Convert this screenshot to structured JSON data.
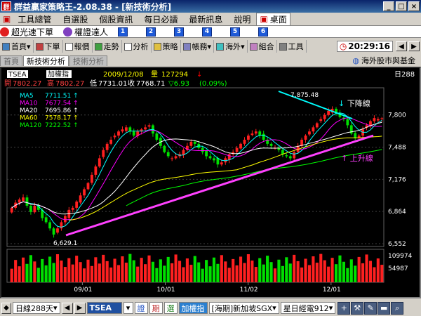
{
  "window": {
    "title": "群益贏家策略王-2.08.38 - [新技術分析]",
    "icon": "app-icon"
  },
  "menu": {
    "items": [
      "工具總管",
      "自選股",
      "個股資訊",
      "每日必讀",
      "最新訊息",
      "說明"
    ],
    "desktop": "桌面"
  },
  "quick": {
    "items": [
      "超光速下單",
      "權證達人"
    ],
    "numbers": [
      "1",
      "2",
      "3",
      "4",
      "5",
      "6"
    ]
  },
  "toolbar": {
    "items": [
      "首頁",
      "下單",
      "報價",
      "走勢",
      "分析",
      "策略",
      "帳務",
      "海外",
      "組合",
      "工具"
    ],
    "clock": "20:29:16"
  },
  "tabs": {
    "items": [
      "首頁",
      "新技術分析",
      "技術分析"
    ],
    "active": 1,
    "overseas": "海外股市與基金"
  },
  "chart_header": {
    "symbol": "TSEA",
    "name": "加權指",
    "date": "2009/12/08",
    "vol_label": "量",
    "vol": "127294",
    "open_label": "開",
    "open": "7802.27",
    "high_label": "高",
    "high": "7802.27",
    "low_label": "低",
    "low": "7731.01",
    "close_label": "收",
    "close": "7768.71",
    "change": "▽6.93",
    "pct": "(0.09%)",
    "period": "日288"
  },
  "ma_legend": [
    {
      "name": "MA5",
      "value": "7711.51",
      "color": "#00ffff"
    },
    {
      "name": "MA10",
      "value": "7677.54",
      "color": "#ff00ff"
    },
    {
      "name": "MA20",
      "value": "7695.86",
      "color": "#ffffff"
    },
    {
      "name": "MA60",
      "value": "7578.17",
      "color": "#ffff00"
    },
    {
      "name": "MA120",
      "value": "7222.52",
      "color": "#00ff00"
    }
  ],
  "annotations": {
    "high": "7,875.48",
    "low": "6,629.1",
    "down": "下降線",
    "up": "上升線"
  },
  "chart_data": {
    "type": "candlestick",
    "ylim": [
      6552,
      8050
    ],
    "yticks": [
      "7,800",
      "7,488",
      "7,176",
      "6,864",
      "6,552"
    ],
    "xticks": [
      "09/01",
      "10/01",
      "11/02",
      "12/01"
    ],
    "vol_ticks": [
      "109974",
      "54987"
    ],
    "closes": [
      6900,
      6950,
      6980,
      7000,
      6920,
      6860,
      6920,
      6880,
      6800,
      6760,
      6700,
      6640,
      6700,
      6760,
      6820,
      6880,
      6900,
      6960,
      7020,
      7080,
      7140,
      7220,
      7300,
      7380,
      7460,
      7520,
      7560,
      7600,
      7640,
      7660,
      7680,
      7640,
      7600,
      7640,
      7660,
      7680,
      7700,
      7620,
      7560,
      7500,
      7440,
      7400,
      7380,
      7400,
      7420,
      7460,
      7500,
      7540,
      7520,
      7480,
      7440,
      7400,
      7380,
      7360,
      7320,
      7340,
      7380,
      7420,
      7440,
      7480,
      7520,
      7560,
      7600,
      7620,
      7640,
      7600,
      7560,
      7520,
      7500,
      7480,
      7460,
      7420,
      7400,
      7380,
      7440,
      7500,
      7560,
      7600,
      7640,
      7680,
      7720,
      7760,
      7800,
      7840,
      7860,
      7820,
      7780,
      7760,
      7700,
      7620,
      7580,
      7600,
      7660,
      7700,
      7740,
      7770,
      7760,
      7768
    ]
  },
  "status": {
    "period": "日線288天",
    "symbol": "TSEA",
    "b1": "證",
    "b2": "期",
    "b3": "選",
    "index": "加權指",
    "overseas": "[海期]新加坡SGX",
    "star": "星日經電912"
  }
}
